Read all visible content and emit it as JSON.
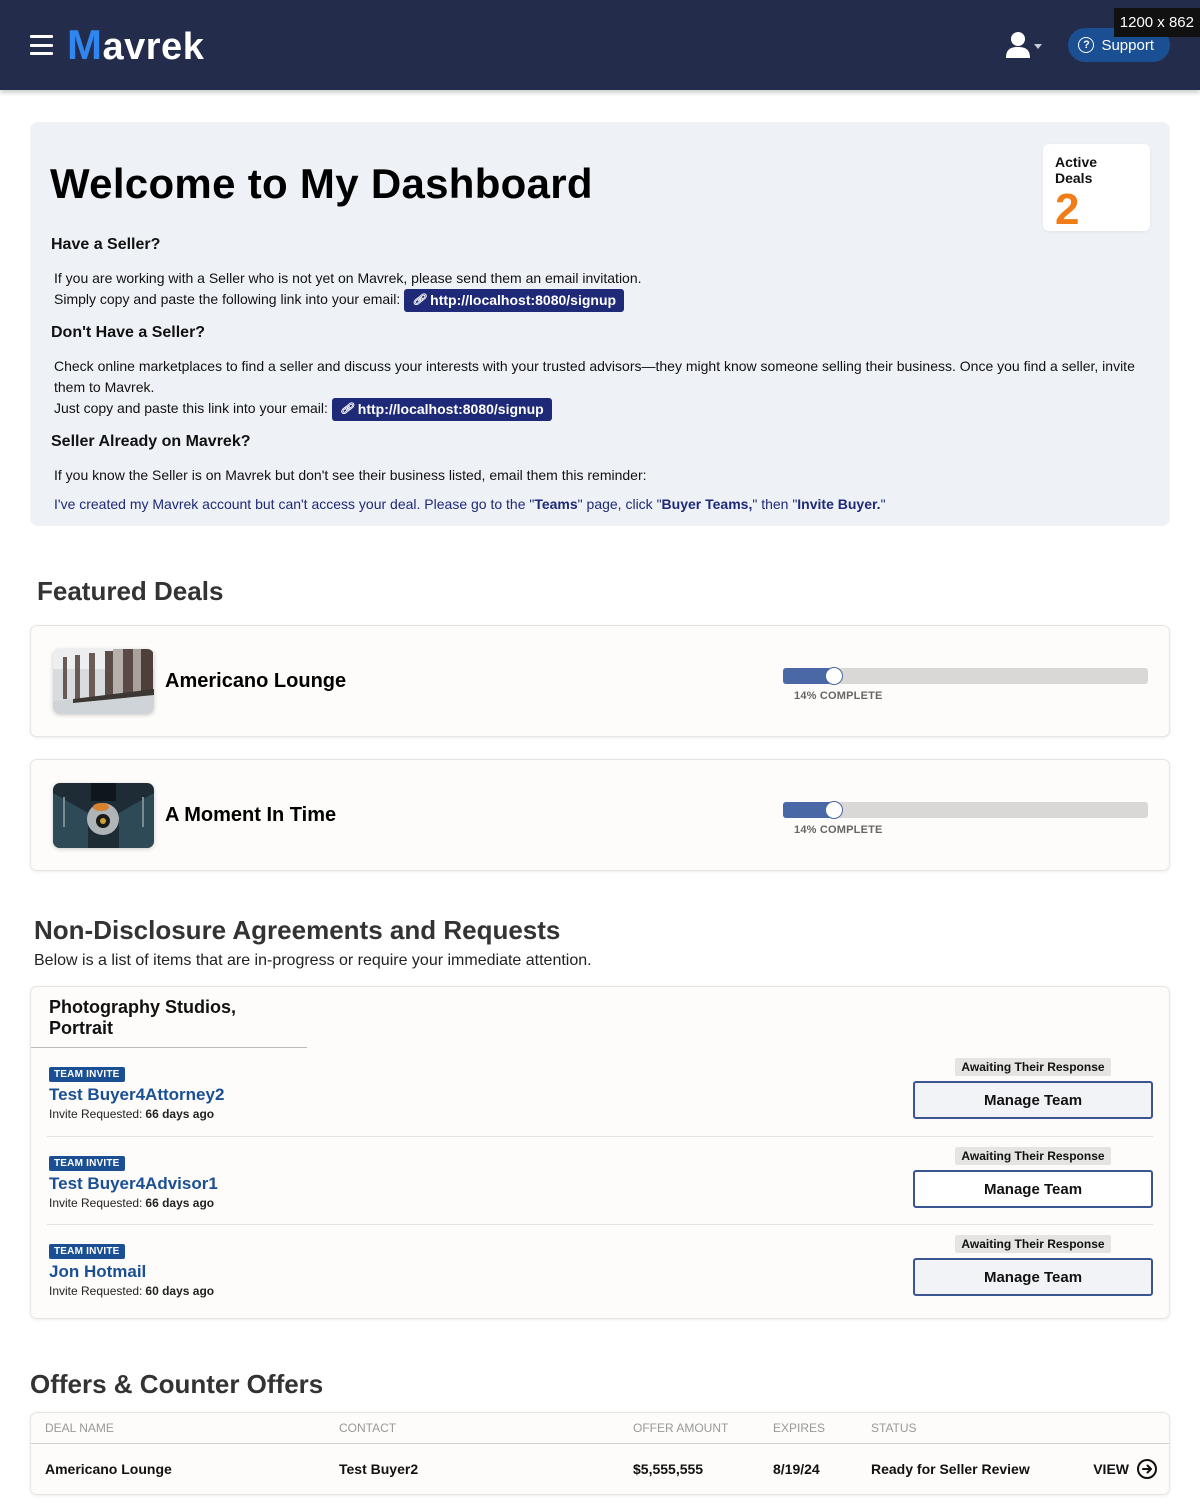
{
  "header": {
    "logo_first": "M",
    "logo_rest": "avrek",
    "support_label": "Support",
    "dims_badge": "1200 x 862",
    "icons": {
      "menu": "hamburger-icon",
      "user": "user-icon",
      "help": "question-circle-icon"
    }
  },
  "welcome": {
    "title": "Welcome to My Dashboard",
    "active_deals": {
      "label": "Active Deals",
      "value": "2",
      "color": "#f07d1a"
    },
    "have_seller": {
      "heading": "Have a Seller?",
      "line1": "If you are working with a Seller who is not yet on Mavrek, please send them an email invitation.",
      "line2": "Simply copy and paste the following link into your email:",
      "link": "http://localhost:8080/signup"
    },
    "no_seller": {
      "heading": "Don't Have a Seller?",
      "line1": "Check online marketplaces to find a seller and discuss your interests with your trusted advisors—they might know someone selling their business. Once you find a seller, invite them to Mavrek.",
      "line2": "Just copy and paste this link into your email:",
      "link": "http://localhost:8080/signup"
    },
    "seller_on_mavrek": {
      "heading": "Seller Already on Mavrek?",
      "line1": "If you know the Seller is on Mavrek but don't see their business listed, email them this reminder:",
      "reminder_a": "I've created my Mavrek account but can't access your deal. Please go to the \"",
      "reminder_teams": "Teams",
      "reminder_b": "\" page, click \"",
      "reminder_buyer_teams": "Buyer Teams,",
      "reminder_c": "\" then \"",
      "reminder_invite": "Invite Buyer.",
      "reminder_d": "\""
    }
  },
  "featured": {
    "title": "Featured Deals",
    "deals": [
      {
        "name": "Americano Lounge",
        "progress_percent": 14,
        "progress_label": "14% COMPLETE"
      },
      {
        "name": "A Moment In Time",
        "progress_percent": 14,
        "progress_label": "14% COMPLETE"
      }
    ]
  },
  "nda": {
    "title": "Non-Disclosure Agreements and Requests",
    "subtitle": "Below is a list of items that are in-progress or require your immediate attention.",
    "group_title": "Photography Studios, Portrait",
    "rows": [
      {
        "badge": "TEAM INVITE",
        "name": "Test Buyer4Attorney2",
        "req_label": "Invite Requested:",
        "req_value": "66 days ago",
        "status": "Awaiting Their Response",
        "button": "Manage Team"
      },
      {
        "badge": "TEAM INVITE",
        "name": "Test Buyer4Advisor1",
        "req_label": "Invite Requested:",
        "req_value": "66 days ago",
        "status": "Awaiting Their Response",
        "button": "Manage Team"
      },
      {
        "badge": "TEAM INVITE",
        "name": "Jon Hotmail",
        "req_label": "Invite Requested:",
        "req_value": "60 days ago",
        "status": "Awaiting Their Response",
        "button": "Manage Team"
      }
    ]
  },
  "offers": {
    "title": "Offers & Counter Offers",
    "columns": [
      "DEAL NAME",
      "CONTACT",
      "OFFER AMOUNT",
      "EXPIRES",
      "STATUS"
    ],
    "rows": [
      {
        "deal": "Americano Lounge",
        "contact": "Test Buyer2",
        "amount": "$5,555,555",
        "expires": "8/19/24",
        "status": "Ready for Seller Review",
        "action": "VIEW"
      }
    ]
  }
}
